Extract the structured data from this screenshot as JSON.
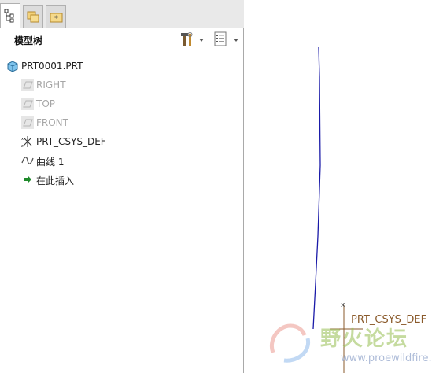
{
  "panel": {
    "title": "模型树",
    "tabs": [
      {
        "name": "model-tree-tab",
        "icon": "tree-structure-icon",
        "active": true
      },
      {
        "name": "folder-browser-tab",
        "icon": "folders-icon",
        "active": false
      },
      {
        "name": "favorites-tab",
        "icon": "favorites-folder-icon",
        "active": false
      }
    ],
    "header_buttons": [
      {
        "name": "settings-dropdown-button",
        "icon": "hammer-wrench-icon"
      },
      {
        "name": "show-dropdown-button",
        "icon": "list-document-icon"
      }
    ]
  },
  "tree": {
    "root": {
      "label": "PRT0001.PRT",
      "icon": "part-cube-icon"
    },
    "items": [
      {
        "label": "RIGHT",
        "icon": "datum-plane-icon",
        "dim": true
      },
      {
        "label": "TOP",
        "icon": "datum-plane-icon",
        "dim": true
      },
      {
        "label": "FRONT",
        "icon": "datum-plane-icon",
        "dim": true
      },
      {
        "label": "PRT_CSYS_DEF",
        "icon": "coordinate-system-icon",
        "dim": false
      },
      {
        "label": "曲线 1",
        "icon": "curve-icon",
        "dim": false
      },
      {
        "label": "在此插入",
        "icon": "insert-here-arrow-icon",
        "dim": false
      }
    ]
  },
  "viewport": {
    "csys_label": "PRT_CSYS_DEF",
    "curve_color": "#1a1aa8",
    "csys_color": "#8a5a2b",
    "watermark_text": "野火论坛",
    "watermark_url": "www.proewildfire.cn"
  }
}
